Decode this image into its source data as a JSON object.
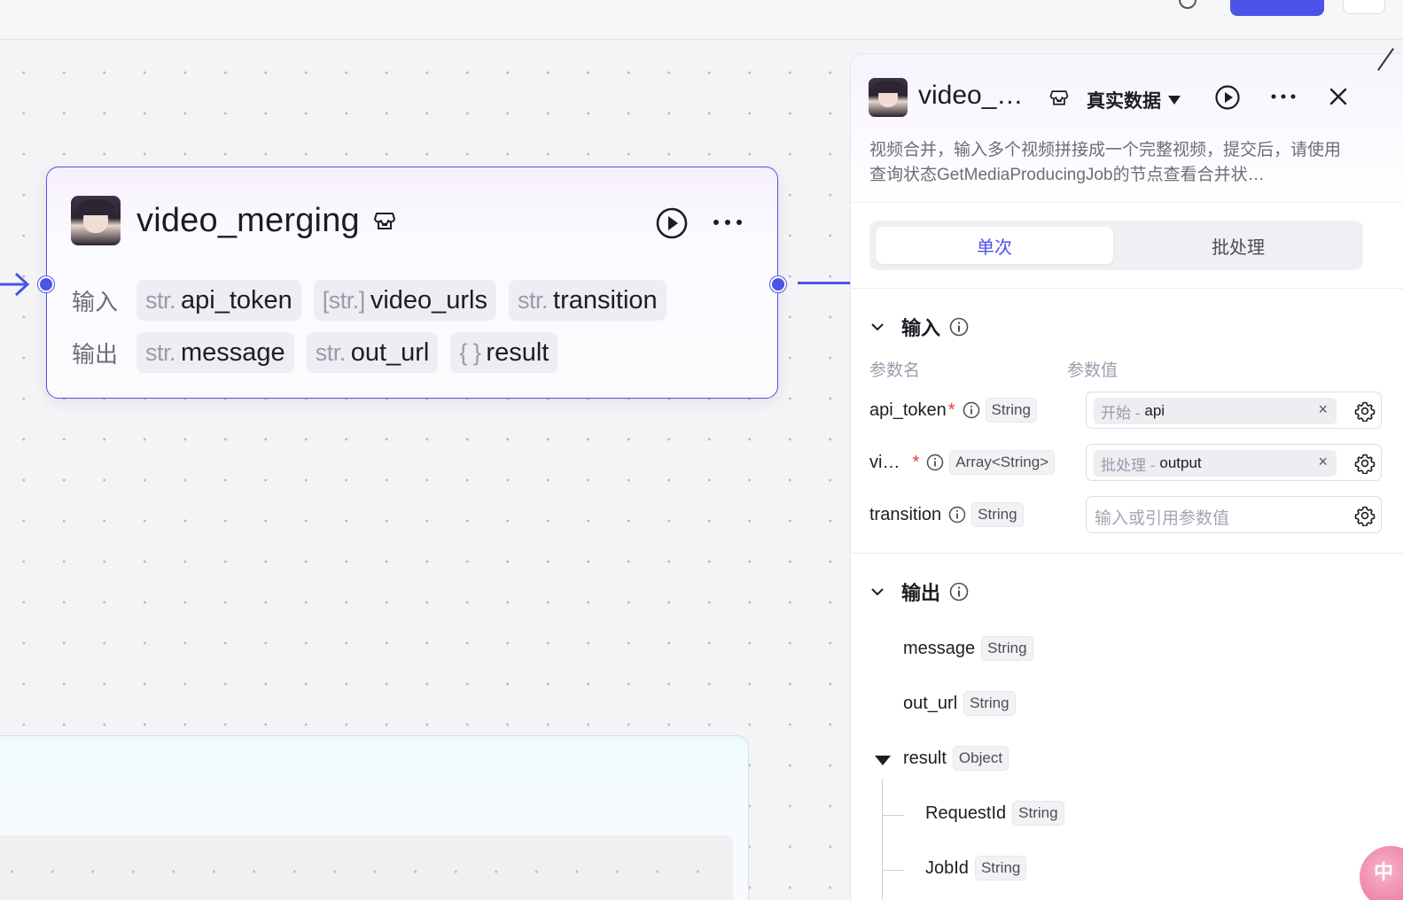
{
  "node": {
    "title": "video_merging",
    "input_label": "输入",
    "output_label": "输出",
    "inputs": [
      {
        "type": "str.",
        "name": "api_token"
      },
      {
        "type": "[str.]",
        "name": "video_urls"
      },
      {
        "type": "str.",
        "name": "transition"
      }
    ],
    "outputs": [
      {
        "type": "str.",
        "name": "message"
      },
      {
        "type": "str.",
        "name": "out_url"
      },
      {
        "type": "{ }",
        "name": "result"
      }
    ]
  },
  "panel": {
    "title": "video_…",
    "mode": "真实数据",
    "description": "视频合并，输入多个视频拼接成一个完整视频，提交后，请使用查询状态GetMediaProducingJob的节点查看合并状…",
    "tabs": {
      "single": "单次",
      "batch": "批处理"
    },
    "input_section": "输入",
    "col_name": "参数名",
    "col_value": "参数值",
    "params": [
      {
        "name": "api_token",
        "required": "*",
        "type": "String",
        "source": "开始 -",
        "ref": "api",
        "remove": "×"
      },
      {
        "name": "vi…",
        "required": "*",
        "type": "Array<String>",
        "source": "批处理 -",
        "ref": "output",
        "remove": "×"
      },
      {
        "name": "transition",
        "type": "String",
        "placeholder": "输入或引用参数值"
      }
    ],
    "output_section": "输出",
    "outputs": [
      {
        "name": "message",
        "type": "String"
      },
      {
        "name": "out_url",
        "type": "String"
      },
      {
        "name": "result",
        "type": "Object"
      },
      {
        "name": "RequestId",
        "type": "String"
      },
      {
        "name": "JobId",
        "type": "String"
      }
    ]
  },
  "floating_button": {
    "label": "中"
  },
  "colors": {
    "accent": "#4d53e8",
    "required": "#e53935"
  }
}
